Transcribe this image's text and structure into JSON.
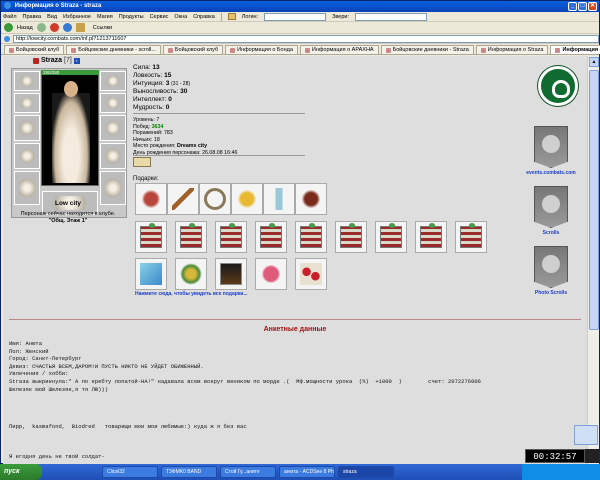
{
  "window": {
    "title": "Информация о Straza - straza",
    "controls": [
      "_",
      "□",
      "✕"
    ]
  },
  "menubar": {
    "items": [
      "Файл",
      "Правка",
      "Вид",
      "Избранное",
      "Магия",
      "Продукты",
      "Сервис",
      "Окна",
      "Справка"
    ],
    "login_label": "Логин:",
    "beasts_label": "Звери:"
  },
  "toolbar": {
    "back_label": "Назад",
    "links_label": "Ссылки"
  },
  "address": {
    "url": "http://lowcity.combats.com/inf.pl?1213711607"
  },
  "tabs": [
    {
      "label": "Бойцовский клуб",
      "active": false
    },
    {
      "label": "Бойцовские дневники - scroll...",
      "active": false
    },
    {
      "label": "Бойцовский клуб",
      "active": false
    },
    {
      "label": "Информация о Бонда",
      "active": false
    },
    {
      "label": "Информация о APAXHA",
      "active": false
    },
    {
      "label": "Бойцовские дневники - Straza",
      "active": false
    },
    {
      "label": "Информация о Straza",
      "active": false
    },
    {
      "label": "Информация о Straza",
      "active": true
    }
  ],
  "character": {
    "nick": "Straza",
    "level": "[7]",
    "hp": "280/280",
    "city": "Low city",
    "location_note": "Персонаж сейчас находится в клубе.",
    "location_room": "\"Общ. Этаж 1\""
  },
  "stats": {
    "strength_label": "Сила:",
    "strength": "13",
    "agility_label": "Ловкость:",
    "agility": "15",
    "intuition_label": "Интуиция:",
    "intuition": "3",
    "intuition_extra": "(31 - 28)",
    "endurance_label": "Выносливость:",
    "endurance": "30",
    "intellect_label": "Интеллект:",
    "intellect": "0",
    "wisdom_label": "Мудрость:",
    "wisdom": "0"
  },
  "facts": {
    "level_label": "Уровень:",
    "level": "7",
    "wins_label": "Побед:",
    "wins": "3634",
    "losses_label": "Поражений:",
    "losses": "783",
    "draws_label": "Ничьих:",
    "draws": "18",
    "birthplace_label": "Место рождения:",
    "birthplace": "Dreams city",
    "birthday_label": "День рождения персонажа:",
    "birthday": "26.08.08 16:46"
  },
  "gifts": {
    "label": "Подарки:",
    "more_link": "Нажмите сюда, чтобы увидеть все подарки..."
  },
  "sidebar": {
    "events_label": "events.combats.com",
    "scrolls_label": "Scrolls",
    "photo_scrolls_label": "Photo Scrolls"
  },
  "profile": {
    "heading": "Анкетные данные",
    "name_line": "Имя: Анюта",
    "gender_line": "Пол: Женский",
    "city_line": "Город: Санкт-Петербург",
    "motto_line": "Девиз: СЧАСТЬЯ ВСЕМ,ДАРОМ!И ПУСТЬ НИКТО НЕ УЙДЕТ ОБИЖЕННЫЙ.",
    "hobby_line": "Увлечения / хобби:",
    "quote_line1": "Strаза выкрикнула:* А по кребту лопатой-НА!\" надавала всем вокруг веником по морде .(  Мф.мощности урока  (%)  +1000  )        счет: 2072276006",
    "quote_line2": "Шелезяк мой Шелезяк,я тя ЛЮ)))",
    "friends_line": "Пирр,  kasmafond,  Biodred   товарищи мои мои любимые:) куда ж я без вас",
    "closing_line": "Я егодня день не твой солдат-"
  },
  "taskbar": {
    "start_label": "пуск",
    "tasks": [
      "Clicel32",
      "T3ФMK0 BAND",
      "Стой Гу...аните",
      "анюта - ACDSee 8 Ph...",
      "straza"
    ]
  },
  "clock": {
    "time": "00:32:57"
  }
}
